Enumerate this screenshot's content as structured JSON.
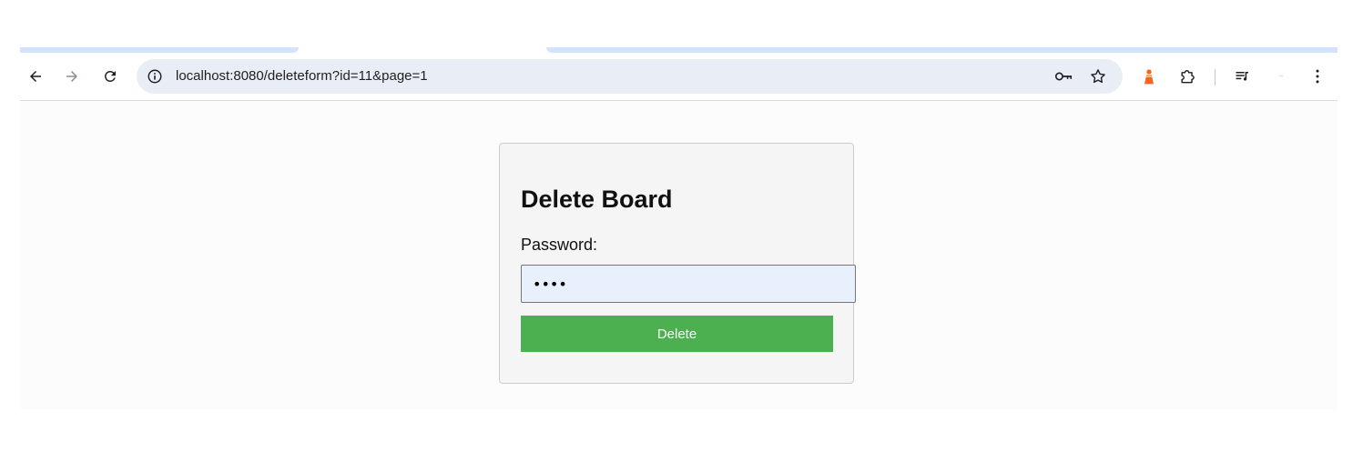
{
  "browser": {
    "address_bar": {
      "url": "localhost:8080/deleteform?id=11&page=1"
    },
    "toolbar_icons": [
      "back-arrow-icon",
      "forward-arrow-icon",
      "reload-icon",
      "site-info-icon",
      "password-key-icon",
      "bookmark-star-icon",
      "extension-icon",
      "puzzle-extensions-icon",
      "media-queue-icon",
      "menu-dots-icon"
    ]
  },
  "form": {
    "title": "Delete Board",
    "password_label": "Password:",
    "password_value": "••••",
    "submit_label": "Delete"
  },
  "colors": {
    "accent_button": "#4caf50",
    "input_autofill_bg": "#e8f0fe",
    "omnibox_bg": "#e9eef6",
    "tab_strip_accent": "#d3e3fd",
    "extension_orange": "#f26522"
  }
}
